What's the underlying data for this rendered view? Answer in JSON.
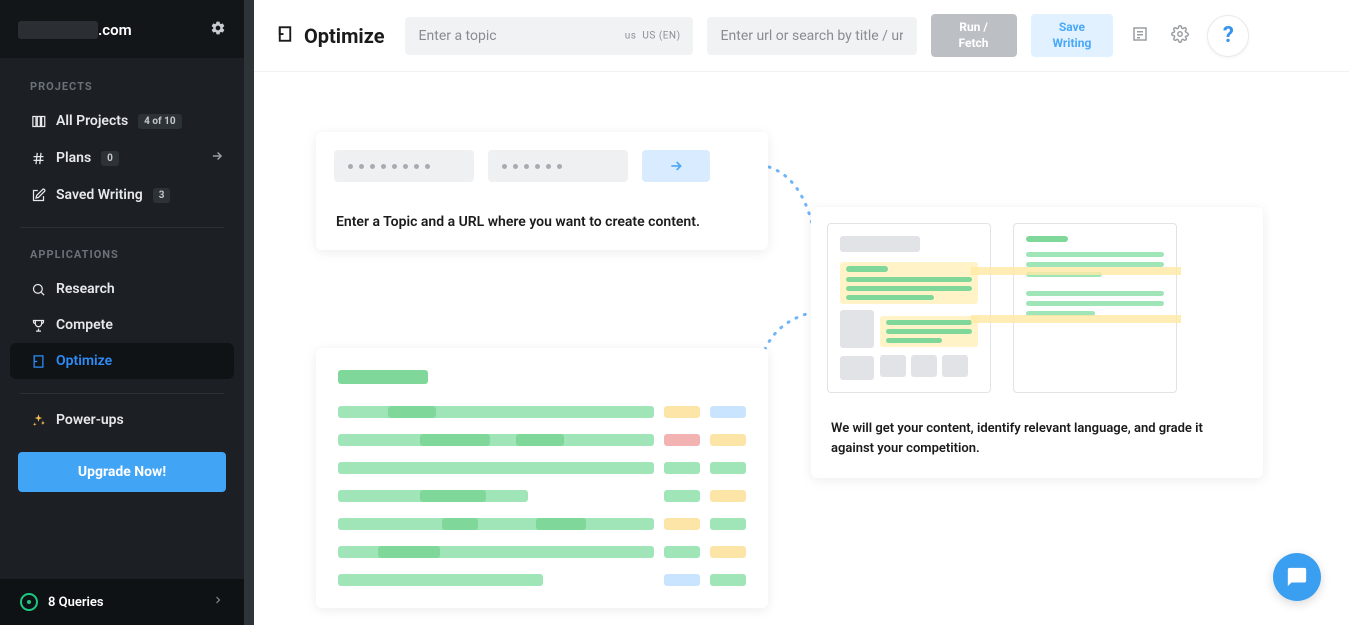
{
  "sidebar": {
    "domain_suffix": ".com",
    "sections": {
      "projects_label": "PROJECTS",
      "applications_label": "APPLICATIONS"
    },
    "items": {
      "all_projects": {
        "label": "All Projects",
        "badge": "4 of 10"
      },
      "plans": {
        "label": "Plans",
        "badge": "0"
      },
      "saved_writing": {
        "label": "Saved Writing",
        "badge": "3"
      },
      "research": {
        "label": "Research"
      },
      "compete": {
        "label": "Compete"
      },
      "optimize": {
        "label": "Optimize"
      },
      "powerups": {
        "label": "Power-ups"
      }
    },
    "upgrade_label": "Upgrade Now!",
    "queries_label": "8 Queries"
  },
  "topbar": {
    "title": "Optimize",
    "topic_placeholder": "Enter a topic",
    "locale_flag": "us",
    "locale_text": "US (EN)",
    "url_placeholder": "Enter url or search by title / url",
    "run_label_line1": "Run /",
    "run_label_line2": "Fetch",
    "save_label_line1": "Save",
    "save_label_line2": "Writing",
    "help_label": "?"
  },
  "onboarding": {
    "step1_text": "Enter a Topic and a URL where you want to create content.",
    "step2_text": "We will get your content, identify relevant language, and grade it against your competition."
  }
}
